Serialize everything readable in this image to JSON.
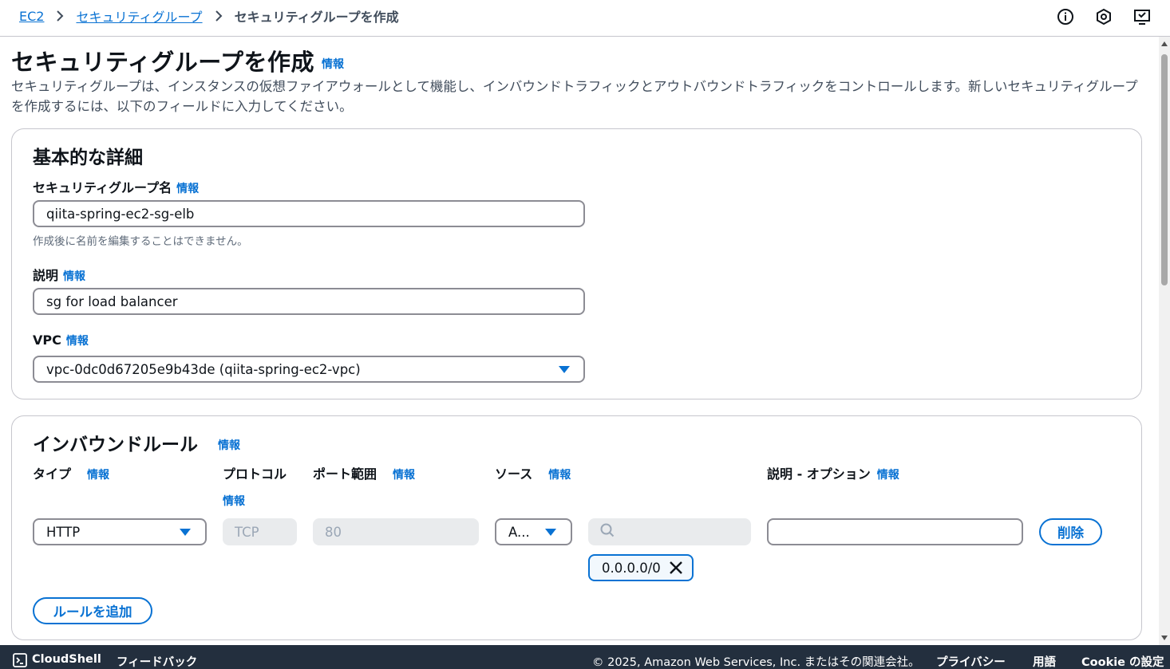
{
  "breadcrumb": {
    "items": [
      "EC2",
      "セキュリティグループ"
    ],
    "current": "セキュリティグループを作成"
  },
  "header": {
    "title": "セキュリティグループを作成",
    "info": "情報",
    "description": "セキュリティグループは、インスタンスの仮想ファイアウォールとして機能し、インバウンドトラフィックとアウトバウンドトラフィックをコントロールします。新しいセキュリティグループを作成するには、以下のフィールドに入力してください。"
  },
  "basic": {
    "title": "基本的な詳細",
    "name_label": "セキュリティグループ名",
    "name_value": "qiita-spring-ec2-sg-elb",
    "name_hint": "作成後に名前を編集することはできません。",
    "desc_label": "説明",
    "desc_value": "sg for load balancer",
    "vpc_label": "VPC",
    "vpc_value": "vpc-0dc0d67205e9b43de (qiita-spring-ec2-vpc)",
    "info": "情報"
  },
  "inbound": {
    "title": "インバウンドルール",
    "info": "情報",
    "columns": {
      "type": "タイプ",
      "protocol": "プロトコル",
      "port": "ポート範囲",
      "source": "ソース",
      "description": "説明 - オプション"
    },
    "rule": {
      "type": "HTTP",
      "protocol": "TCP",
      "port": "80",
      "source": "A...",
      "source_token": "0.0.0.0/0",
      "description": ""
    },
    "delete_label": "削除",
    "add_rule_label": "ルールを追加"
  },
  "footer": {
    "cloudshell": "CloudShell",
    "feedback": "フィードバック",
    "copyright": "© 2025, Amazon Web Services, Inc. またはその関連会社。",
    "privacy": "プライバシー",
    "terms": "用語",
    "cookie": "Cookie の設定"
  },
  "icons": {
    "top": [
      "info-icon",
      "support-icon",
      "notifications-icon"
    ],
    "search": "search-icon",
    "close": "close-icon",
    "cloudshell": "terminal-icon"
  },
  "colors": {
    "accent": "#0972d3",
    "footer_bg": "#232f3e",
    "border": "#8c8c94"
  }
}
